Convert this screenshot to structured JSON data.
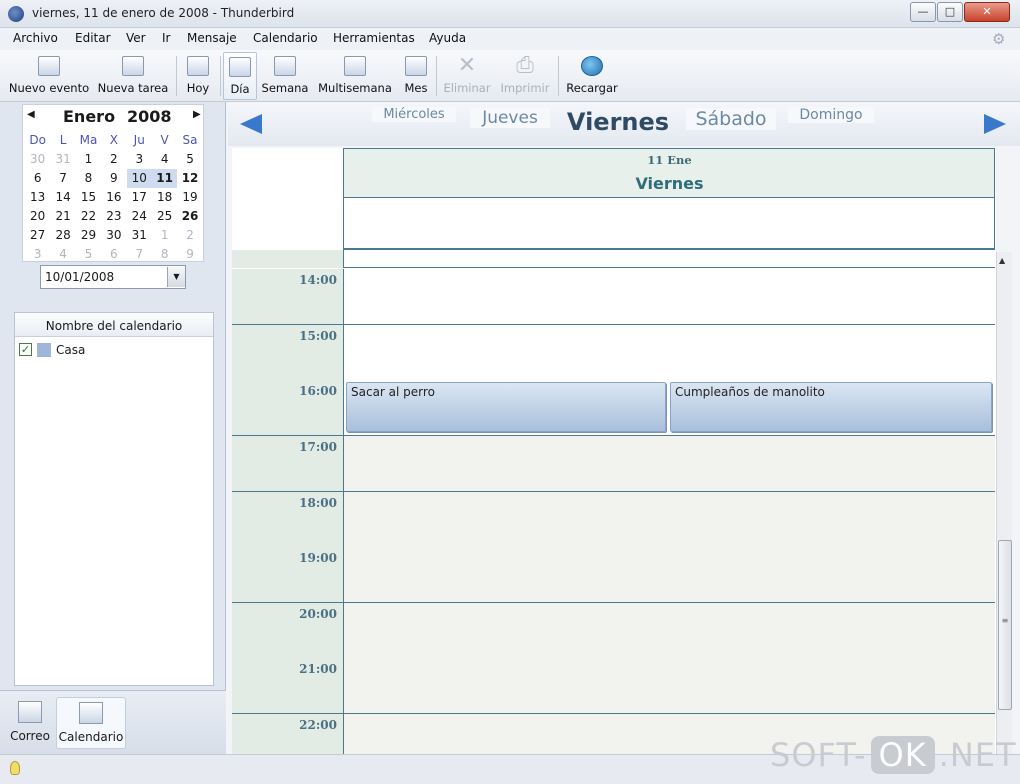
{
  "window": {
    "title": "viernes, 11 de enero de 2008 - Thunderbird",
    "min": "—",
    "max": "□",
    "close": "✕"
  },
  "menu": [
    "Archivo",
    "Editar",
    "Ver",
    "Ir",
    "Mensaje",
    "Calendario",
    "Herramientas",
    "Ayuda"
  ],
  "toolbar": {
    "new_event": "Nuevo evento",
    "new_task": "Nueva tarea",
    "today": "Hoy",
    "day": "Día",
    "week": "Semana",
    "multiweek": "Multisemana",
    "month": "Mes",
    "delete": "Eliminar",
    "print": "Imprimir",
    "reload": "Recargar"
  },
  "minical": {
    "month": "Enero",
    "year": "2008",
    "weekdays": [
      "Do",
      "L",
      "Ma",
      "X",
      "Ju",
      "V",
      "Sa"
    ],
    "days": [
      "30",
      "31",
      "1",
      "2",
      "3",
      "4",
      "5",
      "6",
      "7",
      "8",
      "9",
      "10",
      "11",
      "12",
      "13",
      "14",
      "15",
      "16",
      "17",
      "18",
      "19",
      "20",
      "21",
      "22",
      "23",
      "24",
      "25",
      "26",
      "27",
      "28",
      "29",
      "30",
      "31",
      "1",
      "2",
      "3",
      "4",
      "5",
      "6",
      "7",
      "8",
      "9"
    ]
  },
  "date_field": {
    "value": "10/01/2008"
  },
  "calendars": {
    "header": "Nombre del calendario",
    "items": [
      {
        "name": "Casa",
        "color": "#9fb5d9",
        "checked": true
      }
    ]
  },
  "modes": {
    "mail": "Correo",
    "calendar": "Calendario"
  },
  "day_nav": {
    "tabs": [
      "Miércoles",
      "Jueves",
      "Viernes",
      "Sábado",
      "Domingo"
    ]
  },
  "day_view": {
    "date": "11 Ene",
    "day": "Viernes",
    "hours": [
      "14:00",
      "15:00",
      "16:00",
      "17:00",
      "18:00",
      "19:00",
      "20:00",
      "21:00",
      "22:00"
    ],
    "events": [
      {
        "title": "Sacar al perro",
        "time": "16:00"
      },
      {
        "title": "Cumpleaños de manolito",
        "time": "16:00"
      }
    ]
  },
  "watermark": {
    "pre": "SOFT-",
    "ok": "OK",
    "post": ".NET"
  },
  "colors": {
    "accent": "#3a78cc",
    "grid_line": "#4a7a90",
    "event_fill": "#a8bfdb"
  }
}
